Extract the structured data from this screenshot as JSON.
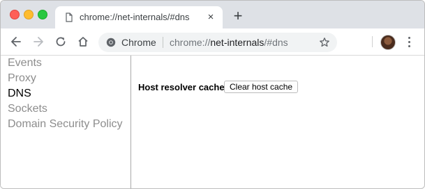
{
  "window": {
    "colors": {
      "tabstrip": "#dee1e6",
      "accent_close": "#fe5f57",
      "accent_min": "#febc2e",
      "accent_max": "#28c840"
    }
  },
  "tab": {
    "title": "chrome://net-internals/#dns",
    "close_label": "×",
    "icon": "document-icon"
  },
  "new_tab_label": "+",
  "toolbar": {
    "back_icon": "back-arrow-icon",
    "forward_icon": "forward-arrow-icon",
    "reload_icon": "reload-icon",
    "home_icon": "home-icon",
    "omnibox": {
      "chip_label": "Chrome",
      "url_scheme": "chrome://",
      "url_host": "net-internals",
      "url_path": "/#dns"
    },
    "bookmark_icon": "star-icon",
    "menu_icon": "kebab-menu-icon"
  },
  "sidebar": {
    "items": [
      {
        "label": "Events",
        "active": false
      },
      {
        "label": "Proxy",
        "active": false
      },
      {
        "label": "DNS",
        "active": true
      },
      {
        "label": "Sockets",
        "active": false
      },
      {
        "label": "Domain Security Policy",
        "active": false
      }
    ]
  },
  "main": {
    "section_label": "Host resolver cache",
    "clear_button_label": "Clear host cache"
  }
}
